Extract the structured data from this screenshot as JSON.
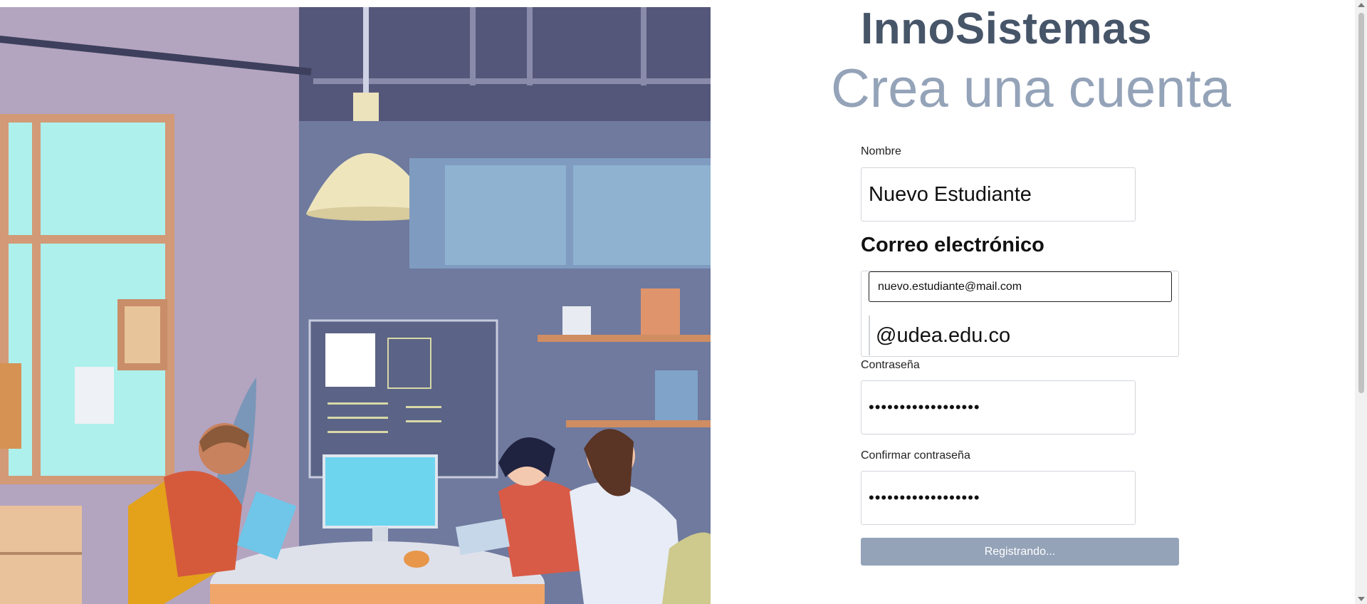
{
  "brand": "InnoSistemas",
  "heading": "Crea una cuenta",
  "form": {
    "name_label": "Nombre",
    "name_value": "Nuevo Estudiante",
    "email_label": "Correo electrónico",
    "email_value": "nuevo.estudiante@mail.com",
    "email_domain": "@udea.edu.co",
    "password_label": "Contraseña",
    "password_value": "••••••••••••••••••",
    "confirm_label": "Confirmar contraseña",
    "confirm_value": "••••••••••••••••••",
    "submit_label": "Registrando..."
  },
  "colors": {
    "brand": "#475569",
    "heading": "#94a3b8",
    "button": "#94a3b8"
  }
}
